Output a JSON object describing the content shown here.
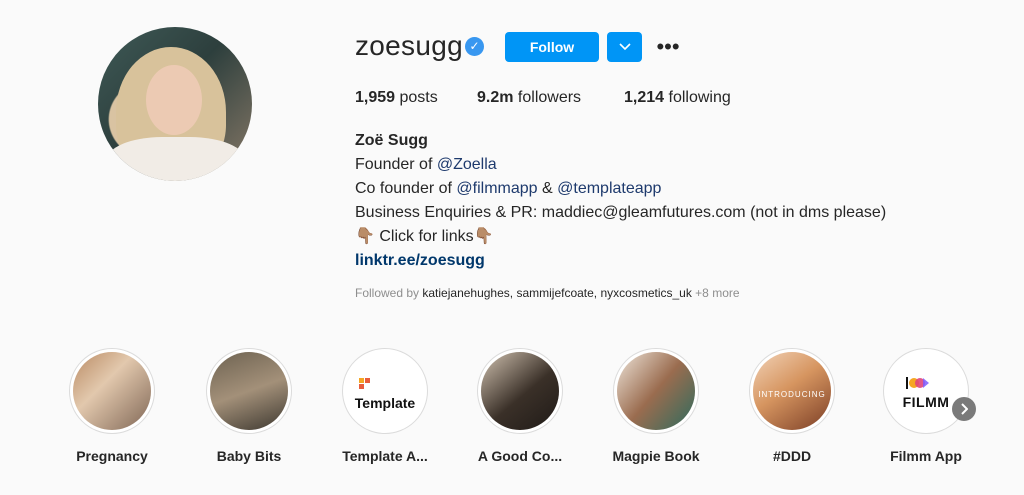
{
  "profile": {
    "username": "zoesugg",
    "verified_icon": "verified-badge-icon",
    "follow_label": "Follow",
    "more_label": "•••"
  },
  "stats": {
    "posts_count": "1,959",
    "posts_label": "posts",
    "followers_count": "9.2m",
    "followers_label": "followers",
    "following_count": "1,214",
    "following_label": "following"
  },
  "bio": {
    "name": "Zoë Sugg",
    "line1_prefix": "Founder of ",
    "line1_mention": "@Zoella",
    "line2_prefix": "Co founder of ",
    "line2_mention1": "@filmmapp",
    "line2_amp": " & ",
    "line2_mention2": "@templateapp",
    "line3": "Business Enquiries & PR: maddiec@gleamfutures.com (not in dms please)",
    "line4": "👇🏽 Click for links👇🏽",
    "link": "linktr.ee/zoesugg"
  },
  "followed_by": {
    "prefix": "Followed by ",
    "names": "katiejanehughes, sammijefcoate, nyxcosmetics_uk",
    "more": " +8 more"
  },
  "highlights": [
    {
      "label": "Pregnancy"
    },
    {
      "label": "Baby Bits"
    },
    {
      "label": "Template A...",
      "image_text": "Template"
    },
    {
      "label": "A Good Co..."
    },
    {
      "label": "Magpie Book"
    },
    {
      "label": "#DDD",
      "image_text": "INTRODUCING"
    },
    {
      "label": "Filmm App",
      "image_text": "FILMM"
    }
  ],
  "colors": {
    "accent": "#0095f6",
    "link": "#00376b",
    "muted": "#8e8e8e",
    "background": "#fafafa"
  }
}
